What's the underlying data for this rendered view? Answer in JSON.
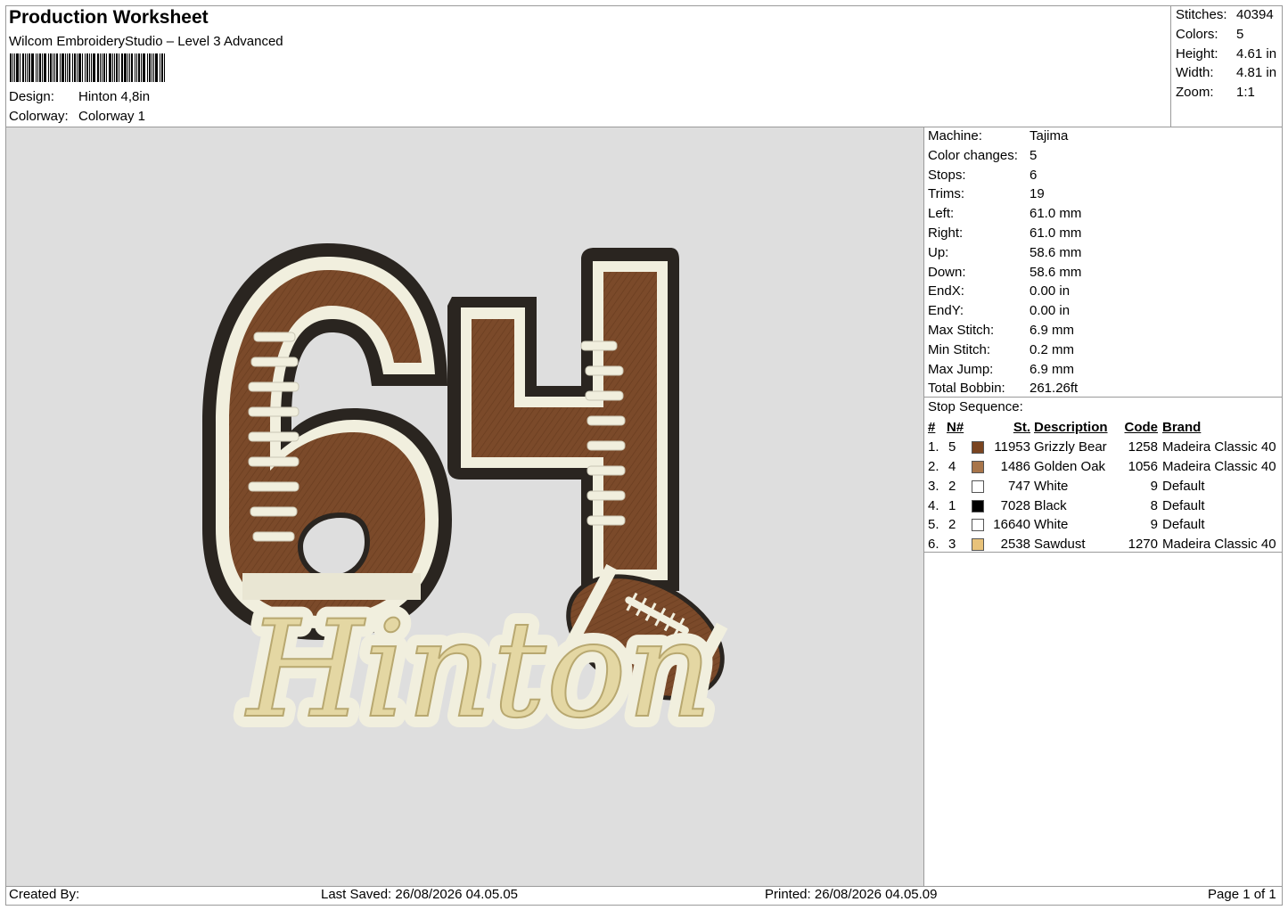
{
  "header": {
    "title": "Production Worksheet",
    "subtitle": "Wilcom EmbroideryStudio – Level 3 Advanced",
    "design_label": "Design:",
    "design_value": "Hinton 4,8in",
    "colorway_label": "Colorway:",
    "colorway_value": "Colorway 1"
  },
  "summary": [
    {
      "label": "Stitches:",
      "value": "40394"
    },
    {
      "label": "Colors:",
      "value": "5"
    },
    {
      "label": "Height:",
      "value": "4.61 in"
    },
    {
      "label": "Width:",
      "value": "4.81 in"
    },
    {
      "label": "Zoom:",
      "value": "1:1"
    }
  ],
  "properties": [
    {
      "label": "Machine:",
      "value": "Tajima"
    },
    {
      "label": "Color changes:",
      "value": "5"
    },
    {
      "label": "Stops:",
      "value": "6"
    },
    {
      "label": "Trims:",
      "value": "19"
    },
    {
      "label": "Left:",
      "value": "61.0 mm"
    },
    {
      "label": "Right:",
      "value": "61.0 mm"
    },
    {
      "label": "Up:",
      "value": "58.6 mm"
    },
    {
      "label": "Down:",
      "value": "58.6 mm"
    },
    {
      "label": "EndX:",
      "value": "0.00 in"
    },
    {
      "label": "EndY:",
      "value": "0.00 in"
    },
    {
      "label": "Max Stitch:",
      "value": "6.9 mm"
    },
    {
      "label": "Min Stitch:",
      "value": "0.2 mm"
    },
    {
      "label": "Max Jump:",
      "value": "6.9 mm"
    },
    {
      "label": "Total Bobbin:",
      "value": "261.26ft"
    }
  ],
  "stop_sequence": {
    "title": "Stop Sequence:",
    "headers": {
      "num": "#",
      "n": "N#",
      "st": "St.",
      "desc": "Description",
      "code": "Code",
      "brand": "Brand"
    },
    "rows": [
      {
        "num": "1.",
        "n": "5",
        "color": "#7a4420",
        "st": "11953",
        "desc": "Grizzly Bear",
        "code": "1258",
        "brand": "Madeira Classic 40"
      },
      {
        "num": "2.",
        "n": "4",
        "color": "#a8754a",
        "st": "1486",
        "desc": "Golden Oak",
        "code": "1056",
        "brand": "Madeira Classic 40"
      },
      {
        "num": "3.",
        "n": "2",
        "color": "#ffffff",
        "st": "747",
        "desc": "White",
        "code": "9",
        "brand": "Default"
      },
      {
        "num": "4.",
        "n": "1",
        "color": "#000000",
        "st": "7028",
        "desc": "Black",
        "code": "8",
        "brand": "Default"
      },
      {
        "num": "5.",
        "n": "2",
        "color": "#ffffff",
        "st": "16640",
        "desc": "White",
        "code": "9",
        "brand": "Default"
      },
      {
        "num": "6.",
        "n": "3",
        "color": "#e8c27a",
        "st": "2538",
        "desc": "Sawdust",
        "code": "1270",
        "brand": "Madeira Classic 40"
      }
    ]
  },
  "design_preview": {
    "digits": "64",
    "name": "Hinton",
    "colors": {
      "brown": "#7b4a2a",
      "cream": "#f1efde",
      "black": "#2a2520",
      "gold": "#e4d7a3",
      "background": "#dedede"
    }
  },
  "footer": {
    "created_by": "Created By:",
    "last_saved": "Last Saved: 26/08/2026 04.05.05",
    "printed": "Printed: 26/08/2026 04.05.09",
    "page": "Page 1 of 1"
  }
}
